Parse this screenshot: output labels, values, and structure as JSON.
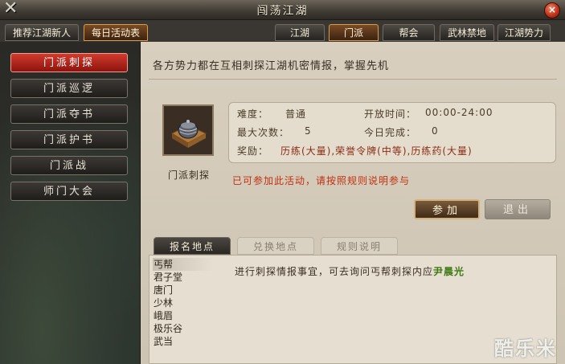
{
  "window": {
    "title": "闯荡江湖",
    "close_label": "×"
  },
  "left_tabs": [
    {
      "label": "推荐江湖新人",
      "active": false
    },
    {
      "label": "每日活动表",
      "active": true
    }
  ],
  "right_tabs": [
    {
      "label": "江湖",
      "active": false
    },
    {
      "label": "门派",
      "active": true
    },
    {
      "label": "帮会",
      "active": false
    },
    {
      "label": "武林禁地",
      "active": false
    },
    {
      "label": "江湖势力",
      "active": false
    }
  ],
  "sidebar": {
    "items": [
      {
        "label": "门派刺探",
        "active": true
      },
      {
        "label": "门派巡逻",
        "active": false
      },
      {
        "label": "门派夺书",
        "active": false
      },
      {
        "label": "门派护书",
        "active": false
      },
      {
        "label": "门派战",
        "active": false
      },
      {
        "label": "师门大会",
        "active": false
      }
    ]
  },
  "activity": {
    "headline": "各方势力都在互相刺探江湖机密情报，掌握先机",
    "icon_name": "incense-burner-icon",
    "icon_label": "门派刺探",
    "difficulty_label": "难度：",
    "difficulty_value": "普通",
    "open_time_label": "开放时间：",
    "open_time_value": "00:00-24:00",
    "max_count_label": "最大次数：",
    "max_count_value": "5",
    "today_done_label": "今日完成：",
    "today_done_value": "0",
    "reward_label": "奖励：",
    "reward_value": "历练(大量),荣誉令牌(中等),历练药(大量)",
    "notice": "已可参加此活动，请按照规则说明参与",
    "join_button": "参加",
    "quit_button": "退出"
  },
  "subtabs": [
    {
      "label": "报名地点",
      "active": true
    },
    {
      "label": "兑换地点",
      "active": false
    },
    {
      "label": "规则说明",
      "active": false
    }
  ],
  "locations": [
    "丐帮",
    "君子堂",
    "唐门",
    "少林",
    "峨眉",
    "极乐谷",
    "武当"
  ],
  "description": {
    "text": "进行刺探情报事宜，可去询问丐帮刺探内应",
    "npc_name": "尹晨光"
  },
  "watermark": "酷乐米",
  "colors": {
    "active_red": "#d23a2c",
    "active_tab": "#d89a45",
    "reward_text": "#8a2c14",
    "notice_text": "#c1300f",
    "npc_text": "#3f7a12"
  }
}
